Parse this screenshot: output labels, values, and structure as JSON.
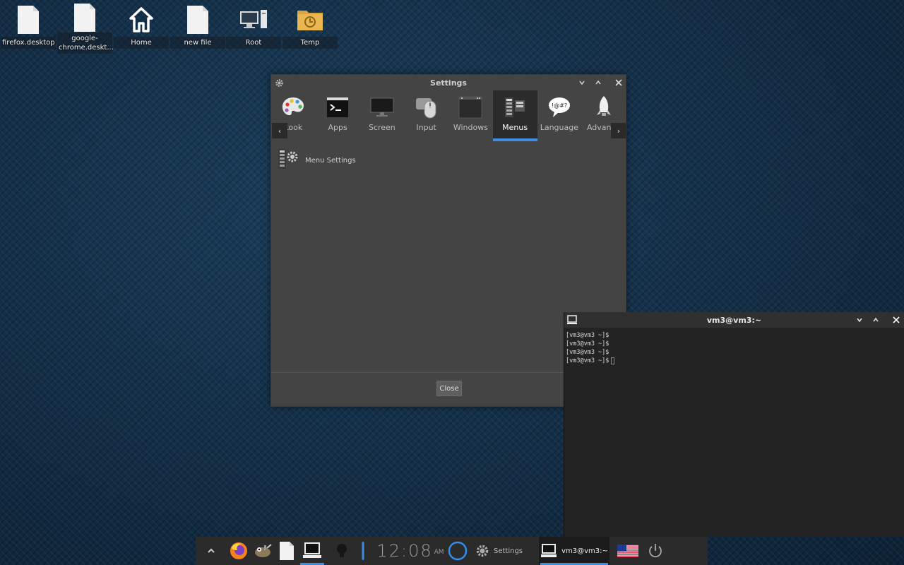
{
  "desktop": {
    "icons": [
      {
        "label": "firefox.desktop"
      },
      {
        "label": "google-chrome.deskt..."
      },
      {
        "label": "Home"
      },
      {
        "label": "new file"
      },
      {
        "label": "Root"
      },
      {
        "label": "Temp"
      }
    ]
  },
  "settings": {
    "title": "Settings",
    "tabs": [
      {
        "label": "Look",
        "icon": "palette-icon"
      },
      {
        "label": "Apps",
        "icon": "terminal-icon"
      },
      {
        "label": "Screen",
        "icon": "monitor-icon"
      },
      {
        "label": "Input",
        "icon": "mouse-icon"
      },
      {
        "label": "Windows",
        "icon": "window-icon"
      },
      {
        "label": "Menus",
        "icon": "menu-icon",
        "active": true
      },
      {
        "label": "Language",
        "icon": "speech-bubble-icon",
        "bubble_text": "!@#?"
      },
      {
        "label": "Advance",
        "icon": "rocket-icon"
      }
    ],
    "content": {
      "item_label": "Menu Settings"
    },
    "close_label": "Close"
  },
  "terminal": {
    "title": "vm3@vm3:~",
    "lines": [
      "[vm3@vm3 ~]$",
      "[vm3@vm3 ~]$",
      "[vm3@vm3 ~]$",
      "[vm3@vm3 ~]$"
    ]
  },
  "taskbar": {
    "clock": "12:08",
    "ampm": "AM",
    "settings_task": "Settings",
    "terminal_task": "vm3@vm3:~"
  },
  "colors": {
    "accent": "#3d8ee0",
    "window_bg": "#444444",
    "terminal_bg": "#232323",
    "taskbar_bg": "#2b2b2b"
  }
}
